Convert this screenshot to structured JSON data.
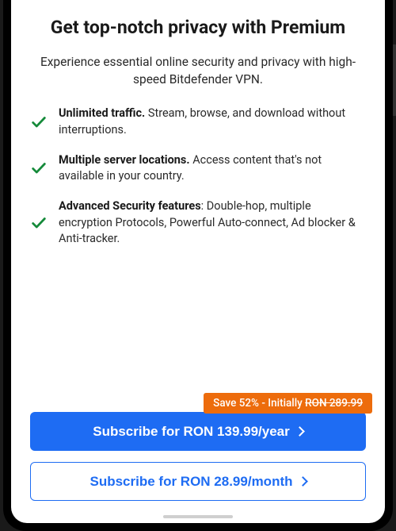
{
  "title": "Get top-notch privacy with Premium",
  "subtitle": "Experience essential online security and privacy with high-speed Bitdefender VPN.",
  "features": [
    {
      "bold": "Unlimited traffic.",
      "rest": " Stream, browse, and download without interruptions."
    },
    {
      "bold": "Multiple server locations.",
      "rest": " Access content that's not available in your country."
    },
    {
      "bold": "Advanced Security features",
      "rest": ": Double-hop, multiple encryption Protocols, Powerful Auto-connect, Ad blocker & Anti-tracker."
    }
  ],
  "badge": {
    "prefix": "Save 52% - Initially ",
    "strike": "RON 289.99"
  },
  "primaryButton": "Subscribe for RON 139.99/year",
  "secondaryButton": "Subscribe for RON 28.99/month"
}
